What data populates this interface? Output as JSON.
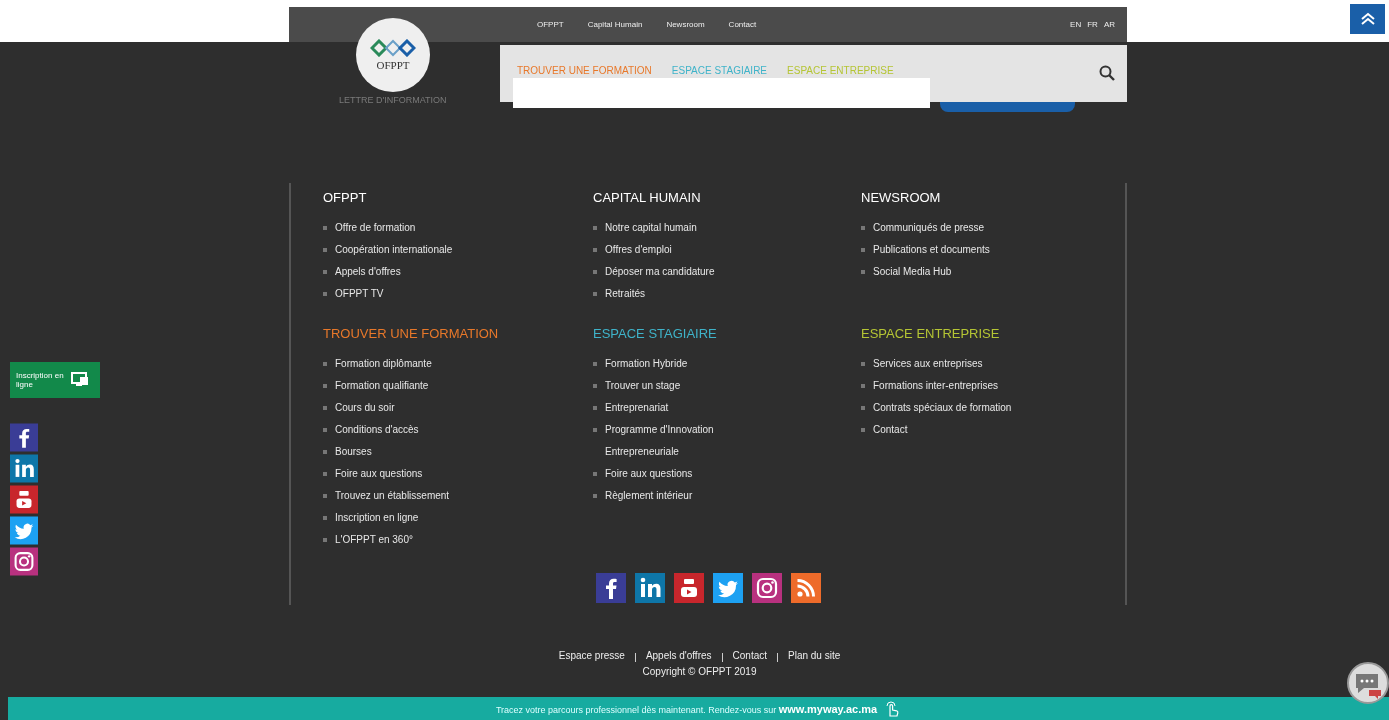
{
  "top_nav": {
    "links": [
      "OFPPT",
      "Capital Humain",
      "Newsroom",
      "Contact"
    ],
    "languages": [
      "EN",
      "FR",
      "AR"
    ]
  },
  "logo": {
    "text": "OFPPT"
  },
  "newsletter": {
    "label": "LETTRE D'INFORMATION"
  },
  "main_menu": {
    "items": [
      {
        "label": "TROUVER UNE FORMATION",
        "color": "#e8782a"
      },
      {
        "label": "ESPACE STAGIAIRE",
        "color": "#3fb3c9"
      },
      {
        "label": "ESPACE ENTREPRISE",
        "color": "#b5c534"
      }
    ]
  },
  "footer_sections": [
    {
      "title": "OFPPT",
      "color": "#ffffff",
      "items": [
        "Offre de formation",
        "Coopération internationale",
        "Appels d'offres",
        "OFPPT TV"
      ]
    },
    {
      "title": "CAPITAL HUMAIN",
      "color": "#ffffff",
      "items": [
        "Notre capital humain",
        "Offres d'emploi",
        "Déposer ma candidature",
        "Retraités"
      ]
    },
    {
      "title": "NEWSROOM",
      "color": "#ffffff",
      "items": [
        "Communiqués de presse",
        "Publications et documents",
        "Social Media Hub"
      ]
    },
    {
      "title": "TROUVER UNE FORMATION",
      "color": "#e8782a",
      "items": [
        "Formation diplômante",
        "Formation qualifiante",
        "Cours du soir",
        "Conditions d'accès",
        "Bourses",
        "Foire aux questions",
        "Trouvez un établissement",
        "Inscription en ligne",
        "L'OFPPT en 360°"
      ]
    },
    {
      "title": "ESPACE STAGIAIRE",
      "color": "#3fb3c9",
      "items": [
        "Formation Hybride",
        "Trouver un stage",
        "Entreprenariat",
        "Programme d'Innovation Entrepreneuriale",
        "Foire aux questions",
        "Règlement intérieur"
      ]
    },
    {
      "title": "ESPACE ENTREPRISE",
      "color": "#b5c534",
      "items": [
        "Services aux entreprises",
        "Formations inter-entreprises",
        "Contrats spéciaux de formation",
        "Contact"
      ]
    }
  ],
  "side_button": {
    "label": "Inscription en ligne"
  },
  "footer_links": [
    "Espace presse",
    "Appels d'offres",
    "Contact",
    "Plan du site"
  ],
  "copyright": "Copyright © OFPPT 2019",
  "banner": {
    "text": "Tracez votre parcours professionnel dès maintenant. Rendez-vous sur",
    "link": "www.myway.ac.ma"
  }
}
